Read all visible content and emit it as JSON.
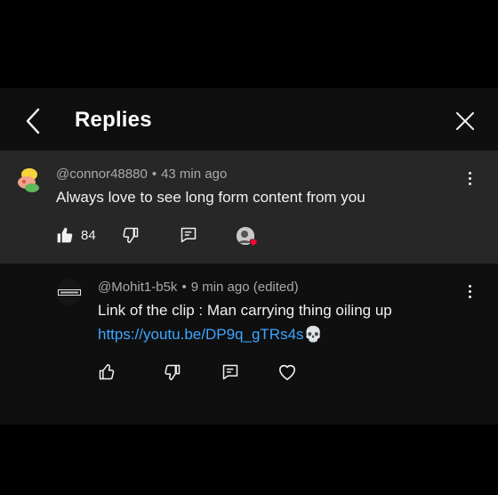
{
  "header": {
    "title": "Replies",
    "back_icon": "chevron-left-icon",
    "close_icon": "close-icon"
  },
  "parent_comment": {
    "author": "@connor48880",
    "separator": "•",
    "time": "43 min ago",
    "text": "Always love to see long form content from you",
    "like_count": "84",
    "creator_hearted": true
  },
  "reply_comment": {
    "author": "@Mohit1-b5k",
    "separator": "•",
    "time": "9 min ago (edited)",
    "text_line1": "Link of the clip : Man carrying thing oiling up",
    "link": "https://youtu.be/DP9q_gTRs4s",
    "emoji": "💀",
    "avatar_label": "SNIPERS"
  },
  "colors": {
    "background": "#000000",
    "panel": "#0f0f0f",
    "parent_highlight": "#272727",
    "link": "#3ea6ff",
    "heart": "#ff0033"
  }
}
